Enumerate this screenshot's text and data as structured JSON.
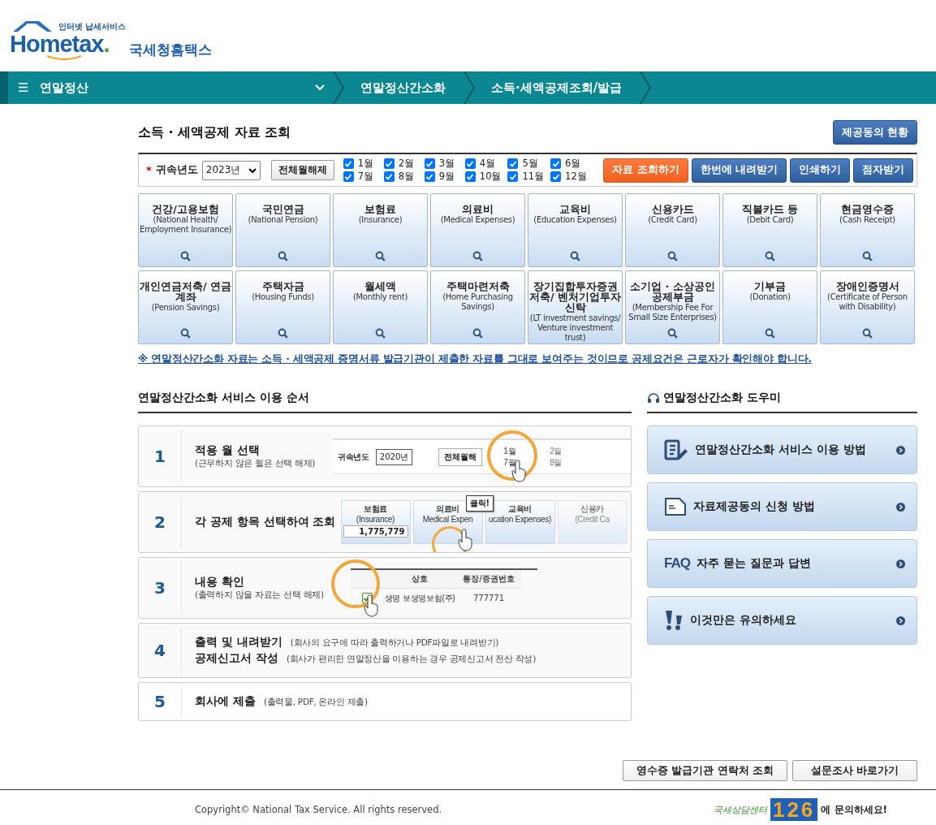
{
  "header": {
    "logo_tagline": "인터넷 납세서비스",
    "logo_word": "Hometax",
    "logo_dot": ".",
    "site_name": "국세청홈택스"
  },
  "nav": {
    "menu_glyph": "☰",
    "menu_label": "연말정산",
    "breadcrumbs": [
      "연말정산간소화",
      "소득·세액공제조회/발급"
    ]
  },
  "page_title": "소득 · 세액공제 자료 조회",
  "status_button": "제공동의 현황",
  "filter": {
    "required_mark": "*",
    "year_label": "귀속년도",
    "year_value": "2023년",
    "clear_button": "전체월해제",
    "months": [
      {
        "label": "1월",
        "checked": true
      },
      {
        "label": "2월",
        "checked": true
      },
      {
        "label": "3월",
        "checked": true
      },
      {
        "label": "4월",
        "checked": true
      },
      {
        "label": "5월",
        "checked": true
      },
      {
        "label": "6월",
        "checked": true
      },
      {
        "label": "7월",
        "checked": true
      },
      {
        "label": "8월",
        "checked": true
      },
      {
        "label": "9월",
        "checked": true
      },
      {
        "label": "10월",
        "checked": true
      },
      {
        "label": "11월",
        "checked": true
      },
      {
        "label": "12월",
        "checked": true
      }
    ],
    "actions": [
      {
        "label": "자료 조회하기",
        "kind": "primary"
      },
      {
        "label": "한번에 내려받기",
        "kind": "normal"
      },
      {
        "label": "인쇄하기",
        "kind": "normal"
      },
      {
        "label": "점자받기",
        "kind": "normal"
      }
    ]
  },
  "categories": [
    {
      "title": "건강/고용보험",
      "subtitle": "(National Health/ Employment Insurance)"
    },
    {
      "title": "국민연금",
      "subtitle": "(National Pension)"
    },
    {
      "title": "보험료",
      "subtitle": "(Insurance)"
    },
    {
      "title": "의료비",
      "subtitle": "(Medical Expenses)"
    },
    {
      "title": "교육비",
      "subtitle": "(Education Expenses)"
    },
    {
      "title": "신용카드",
      "subtitle": "(Credit Card)"
    },
    {
      "title": "직불카드 등",
      "subtitle": "(Debit Card)"
    },
    {
      "title": "현금영수증",
      "subtitle": "(Cash Receipt)"
    },
    {
      "title": "개인연금저축/ 연금계좌",
      "subtitle": "(Pension Savings)"
    },
    {
      "title": "주택자금",
      "subtitle": "(Housing Funds)"
    },
    {
      "title": "월세액",
      "subtitle": "(Monthly rent)"
    },
    {
      "title": "주택마련저축",
      "subtitle": "(Home Purchasing Savings)"
    },
    {
      "title": "장기집합투자증권저축/ 벤처기업투자신탁",
      "subtitle": "(LT investment savings/ Venture investment trust)"
    },
    {
      "title": "소기업 · 소상공인 공제부금",
      "subtitle": "(Membership Fee For Small Size Enterprises)"
    },
    {
      "title": "기부금",
      "subtitle": "(Donation)"
    },
    {
      "title": "장애인증명서",
      "subtitle": "(Certificate of Person with Disability)"
    }
  ],
  "notice": "※ 연말정산간소화 자료는 소득 · 세액공제 증명서류 발급기관이 제출한 자료를 그대로 보여주는 것이므로 공제요건은 근로자가 확인해야 합니다.",
  "steps_section": {
    "title": "연말정산간소화 서비스 이용 순서",
    "steps": [
      {
        "number": "1",
        "kind": "stacked",
        "lines": [
          {
            "title": "적용 월 선택",
            "note": "(근무하지 않은 월은 선택 해제)"
          }
        ],
        "illustration": {
          "kind": "month-select",
          "texts": [
            "귀속년도",
            "2020년",
            "전체월해",
            "1월",
            "7월",
            "2월",
            "8월"
          ]
        }
      },
      {
        "number": "2",
        "kind": "stacked",
        "lines": [
          {
            "title": "각 공제 항목 선택하여 조회"
          }
        ],
        "illustration": {
          "kind": "category-click",
          "texts": [
            "보험료",
            "(Insurance)",
            "1,775,779",
            "의료비",
            "Medical Expen",
            "교육비",
            "ucation Expenses)",
            "신용카",
            "(Credit Ca",
            "클릭!"
          ]
        }
      },
      {
        "number": "3",
        "kind": "stacked",
        "lines": [
          {
            "title": "내용 확인",
            "note": "(출력하지 않을 자료는 선택 해제)"
          }
        ],
        "illustration": {
          "kind": "row-check",
          "row_checked": true,
          "texts": [
            "상호",
            "통장/증권번호",
            "생명",
            "보생명보험(주)",
            "777771"
          ]
        }
      },
      {
        "number": "4",
        "kind": "inline",
        "lines": [
          {
            "title": "출력 및 내려받기",
            "note": "(회사의 요구에 따라 출력하거나 PDF파일로 내려받기)"
          },
          {
            "title": "공제신고서 작성",
            "note": "(회사가 편리한 연말정산을 이용하는 경우 공제신고서 전산 작성)"
          }
        ]
      },
      {
        "number": "5",
        "kind": "inline",
        "lines": [
          {
            "title": "회사에 제출",
            "note": "(출력물, PDF, 온라인 제출)"
          }
        ]
      }
    ]
  },
  "help_section": {
    "title": "연말정산간소화 도우미",
    "items": [
      {
        "kind": "guide",
        "label": "연말정산간소화 서비스 이용 방법"
      },
      {
        "kind": "document",
        "label": "자료제공동의 신청 방법"
      },
      {
        "kind": "faq",
        "badge": "FAQ",
        "label": "자주 묻는 질문과 답변"
      },
      {
        "kind": "warning",
        "label": "이것만은 유의하세요"
      }
    ]
  },
  "bottom_buttons": [
    "영수증 발급기관 연락처 조회",
    "설문조사 바로가기"
  ],
  "footer": {
    "copyright": "Copyright© National Tax Service. All rights reserved.",
    "center_name": "국세상담센터",
    "center_number": "126",
    "center_text": "에 문의하세요!"
  }
}
